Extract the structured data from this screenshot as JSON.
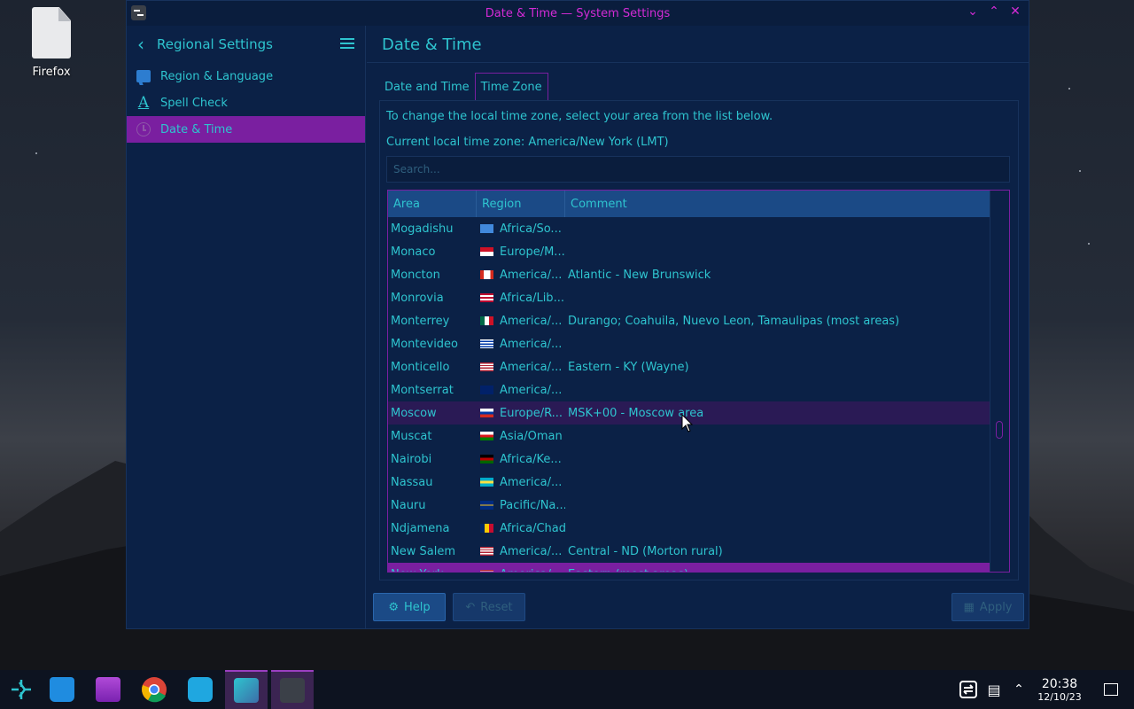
{
  "desktop": {
    "icon_label": "Firefox"
  },
  "window": {
    "title": "Date & Time — System Settings",
    "controls": [
      "minimize",
      "maximize",
      "close"
    ]
  },
  "sidebar": {
    "title": "Regional Settings",
    "items": [
      {
        "label": "Region & Language",
        "icon": "flag-icon"
      },
      {
        "label": "Spell Check",
        "icon": "spell-check-icon"
      },
      {
        "label": "Date & Time",
        "icon": "clock-icon",
        "active": true
      }
    ]
  },
  "main": {
    "title": "Date & Time",
    "tabs": [
      {
        "label": "Date and Time"
      },
      {
        "label": "Time Zone",
        "active": true
      }
    ],
    "hint": "To change the local time zone, select your area from the list below.",
    "current_zone": "Current local time zone: America/New York (LMT)",
    "search_placeholder": "Search...",
    "table": {
      "headers": [
        "Area",
        "Region",
        "Comment"
      ],
      "rows": [
        {
          "area": "Mogadishu",
          "region": "Africa/So...",
          "comment": "",
          "flag": "so"
        },
        {
          "area": "Monaco",
          "region": "Europe/M...",
          "comment": "",
          "flag": "mc"
        },
        {
          "area": "Moncton",
          "region": "America/...",
          "comment": "Atlantic - New Brunswick",
          "flag": "ca"
        },
        {
          "area": "Monrovia",
          "region": "Africa/Lib...",
          "comment": "",
          "flag": "lr"
        },
        {
          "area": "Monterrey",
          "region": "America/...",
          "comment": "Durango; Coahuila, Nuevo Leon, Tamaulipas (most areas)",
          "flag": "mx"
        },
        {
          "area": "Montevideo",
          "region": "America/...",
          "comment": "",
          "flag": "uy"
        },
        {
          "area": "Monticello",
          "region": "America/...",
          "comment": "Eastern - KY (Wayne)",
          "flag": "us"
        },
        {
          "area": "Montserrat",
          "region": "America/...",
          "comment": "",
          "flag": "ms"
        },
        {
          "area": "Moscow",
          "region": "Europe/R...",
          "comment": "MSK+00 - Moscow area",
          "flag": "ru",
          "hover": true
        },
        {
          "area": "Muscat",
          "region": "Asia/Oman",
          "comment": "",
          "flag": "om"
        },
        {
          "area": "Nairobi",
          "region": "Africa/Ke...",
          "comment": "",
          "flag": "ke"
        },
        {
          "area": "Nassau",
          "region": "America/...",
          "comment": "",
          "flag": "bs"
        },
        {
          "area": "Nauru",
          "region": "Pacific/Na...",
          "comment": "",
          "flag": "nr"
        },
        {
          "area": "Ndjamena",
          "region": "Africa/Chad",
          "comment": "",
          "flag": "td"
        },
        {
          "area": "New Salem",
          "region": "America/...",
          "comment": "Central - ND (Morton rural)",
          "flag": "us"
        },
        {
          "area": "New York",
          "region": "America/...",
          "comment": "Eastern (most areas)",
          "flag": "us",
          "selected": true
        }
      ]
    },
    "buttons": {
      "help": "Help",
      "reset": "Reset",
      "apply": "Apply"
    }
  },
  "taskbar": {
    "items": [
      "launcher-icon",
      "discover-icon",
      "files-icon",
      "chrome-icon",
      "kde-connect-icon",
      "system-settings-icon",
      "konsole-icon"
    ],
    "time": "20:38",
    "date": "12/10/23"
  },
  "colors": {
    "accent": "#7a1fa0",
    "text": "#2ec4cf",
    "window_bg": "#0b2146",
    "header_bg": "#1b4a86",
    "title_text": "#d42bd6"
  }
}
